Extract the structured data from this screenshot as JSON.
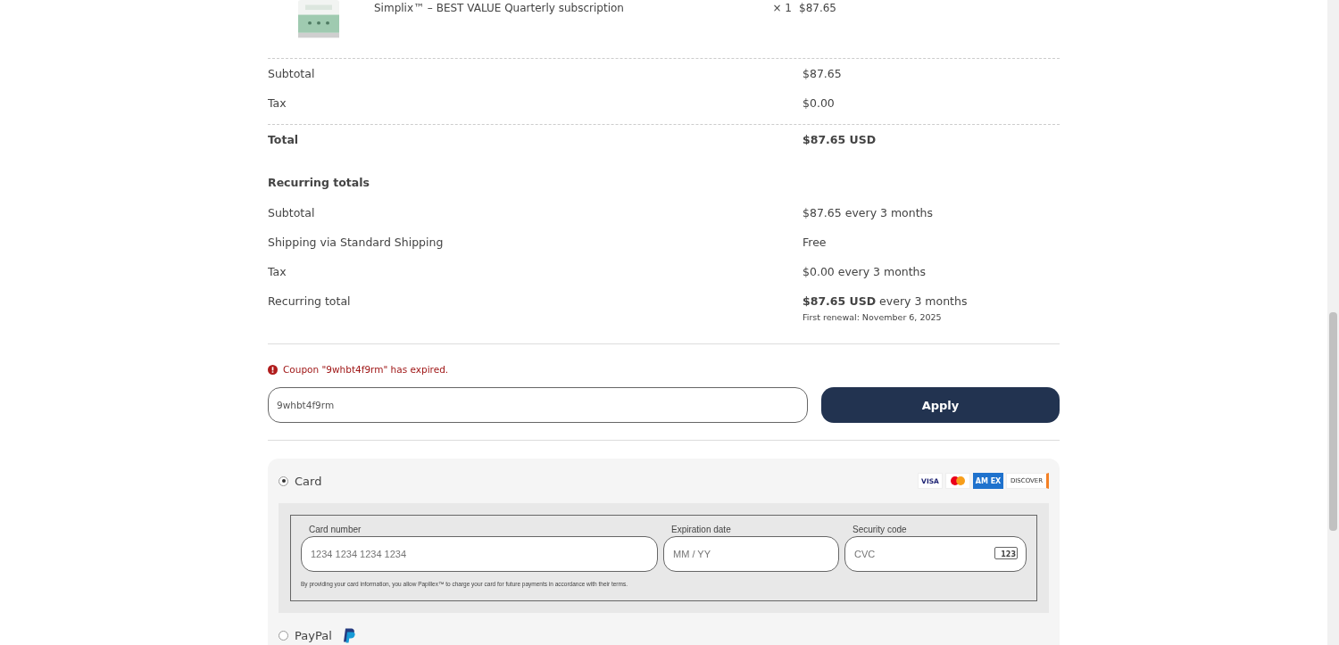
{
  "order_item": {
    "name": "Simplix™ – BEST VALUE Quarterly subscription",
    "quantity": "× 1",
    "price": "$87.65"
  },
  "totals": [
    {
      "label": "Subtotal",
      "value": "$87.65",
      "bold": false
    },
    {
      "label": "Tax",
      "value": "$0.00",
      "bold": false
    },
    {
      "label": "Total",
      "value": "$87.65 USD",
      "bold": true
    }
  ],
  "recurring": {
    "heading": "Recurring totals",
    "rows": [
      {
        "label": "Subtotal",
        "value": "$87.65 every 3 months"
      },
      {
        "label": "Shipping via Standard Shipping",
        "value": "Free"
      },
      {
        "label": "Tax",
        "value": "$0.00 every 3 months"
      },
      {
        "label": "Recurring total",
        "value": "**$87.65 USD** every 3 months",
        "note": "First renewal: November 6, 2025"
      }
    ]
  },
  "coupon": {
    "error": "Coupon \"9whbt4f9rm\" has expired.",
    "value": "9whbt4f9rm",
    "button": "Apply"
  },
  "payment_methods": [
    {
      "kind": "card",
      "label": "Card",
      "selected": true,
      "brands": [
        {
          "kind": "visa",
          "label": "VISA"
        },
        {
          "kind": "mastercard"
        },
        {
          "kind": "amex",
          "label": "AM EX"
        },
        {
          "kind": "discover",
          "label": "DISCOVER"
        }
      ],
      "fields": [
        {
          "label": "Card number",
          "placeholder": "1234 1234 1234 1234",
          "kind": "text"
        },
        {
          "label": "Expiration date",
          "placeholder": "MM / YY",
          "kind": "text"
        },
        {
          "label": "Security code",
          "placeholder": "CVC",
          "kind": "cvc",
          "icon_text": "123"
        }
      ],
      "notice": "By providing your card information, you allow Papillex™ to charge your card for future payments in accordance with their terms."
    },
    {
      "kind": "paypal",
      "label": "PayPal",
      "selected": false
    }
  ]
}
